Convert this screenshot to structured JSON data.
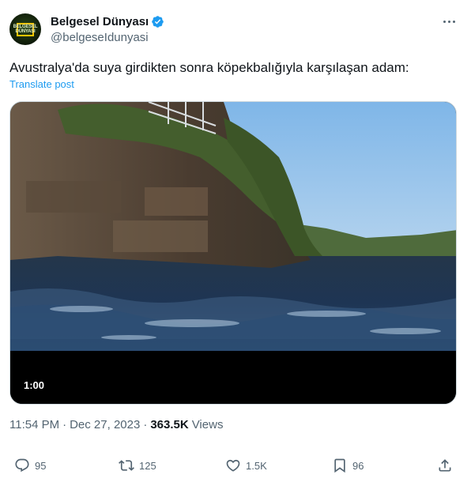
{
  "author": {
    "display_name": "Belgesel Dünyası",
    "handle": "@belgeseIdunyasi",
    "verified": true,
    "avatar_text": "BELGESEL DÜNYASI"
  },
  "tweet": {
    "text": "Avustralya'da suya girdikten sonra köpekbalığıyla karşılaşan adam:",
    "translate_label": "Translate post"
  },
  "video": {
    "duration": "1:00"
  },
  "meta": {
    "time": "11:54 PM",
    "separator": "·",
    "date": "Dec 27, 2023",
    "views_count": "363.5K",
    "views_label": "Views"
  },
  "actions": {
    "replies": "95",
    "reposts": "125",
    "likes": "1.5K",
    "bookmarks": "96"
  },
  "colors": {
    "accent": "#1d9bf0",
    "text_primary": "#0f1419",
    "text_secondary": "#536471",
    "border": "#cfd9de"
  },
  "icons": {
    "verified": "verified-badge-icon",
    "more": "more-icon",
    "reply": "reply-icon",
    "retweet": "retweet-icon",
    "like": "heart-icon",
    "bookmark": "bookmark-icon",
    "share": "share-icon"
  }
}
